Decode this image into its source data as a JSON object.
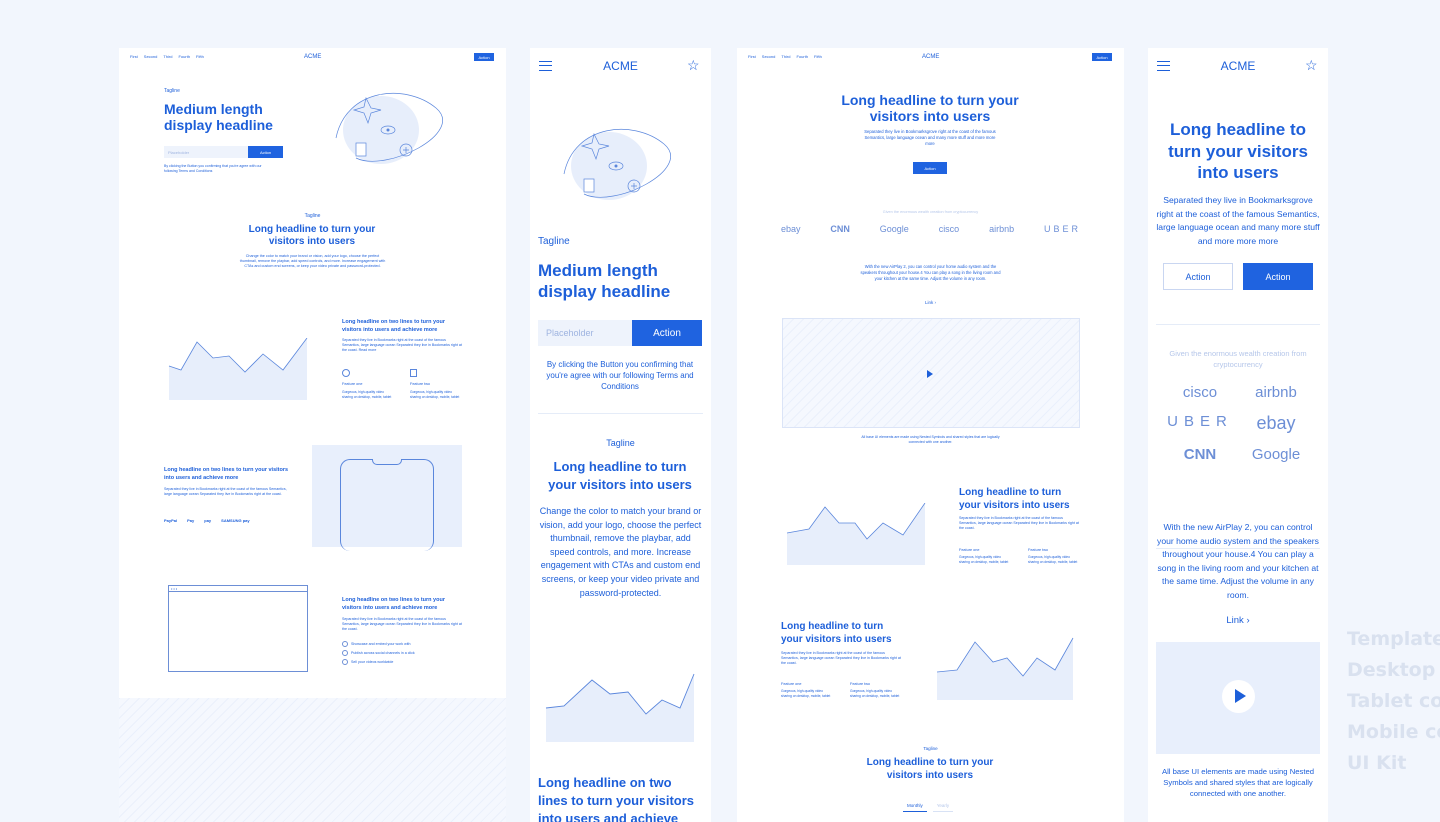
{
  "frame1": {
    "nav": [
      "First",
      "Second",
      "Third",
      "Fourth",
      "Fifth"
    ],
    "logo": "ACME",
    "action": "Action",
    "hero": {
      "tagline": "Tagline",
      "headline": "Medium length display headline",
      "placeholder": "Placeholder",
      "button": "Action",
      "legal": "By clicking the Button you confirming that you're agree with our following Terms and Conditions"
    },
    "section2": {
      "tagline": "Tagline",
      "headline": "Long headline to turn your visitors into users",
      "body": "Change the color to match your brand or vision, add your logo, choose the perfect thumbnail, remove the playbar, add speed controls, and more. Increase engagement with CTAs and custom end screens, or keep your video private and password-protected."
    },
    "section3": {
      "headline": "Long headline on two lines to turn your visitors into users and achieve more",
      "body": "Separated they live in Bookmarks right at the coast of the famous Semantics, large language ocean Separated they live in Bookmarks right at the coast. Read more",
      "f1_title": "Feature one",
      "f1_text": "Gorgeous, high-quality video sharing on desktop, mobile, tablet",
      "f2_title": "Feature two",
      "f2_text": "Gorgeous, high-quality video sharing on desktop, mobile, tablet"
    },
    "section4": {
      "headline": "Long headline on two lines to turn your visitors into users and achieve more",
      "body": "Separated they live in Bookmarks right at the coast of the famous Semantics, large language ocean Separated they live in Bookmarks right at the coast.",
      "logos": [
        "PayPal",
        "Pay",
        "pay",
        "SAMSUNG pay"
      ]
    },
    "section5": {
      "headline": "Long headline on two lines to turn your visitors into users and achieve more",
      "body": "Separated they live in Bookmarks right at the coast of the famous Semantics, large language ocean Separated they live in Bookmarks right at the coast.",
      "checks": [
        "Showcase and embed your work with",
        "Publish across social channels in a click",
        "Sell your videos worldwide"
      ]
    }
  },
  "frame2": {
    "logo": "ACME",
    "tagline": "Tagline",
    "headline": "Medium length display headline",
    "placeholder": "Placeholder",
    "button": "Action",
    "legal": "By clicking the Button you confirming that you're agree with our following Terms and Conditions",
    "tagline2": "Tagline",
    "headline2": "Long headline to turn your visitors into users",
    "body2": "Change the color to match your brand or vision, add your logo, choose the perfect thumbnail, remove the playbar, add speed controls, and more. Increase engagement with CTAs and custom end screens, or keep your video private and password-protected.",
    "headline3": "Long headline on two lines to turn your visitors into users and achieve"
  },
  "frame3": {
    "nav": [
      "First",
      "Second",
      "Third",
      "Fourth",
      "Fifth"
    ],
    "logo": "ACME",
    "action": "Action",
    "headline": "Long headline to turn your visitors into users",
    "body": "Separated they live in Bookmarksgrove right at the coast of the famous Semantics, large language ocean and many more stuff and more more more",
    "button": "Action",
    "logos_caption": "Given the enormous wealth creation from cryptocurrency",
    "logos": [
      "ebay",
      "CNN",
      "Google",
      "cisco",
      "airbnb",
      "UBER"
    ],
    "airplay": "With the new AirPlay 2, you can control your home audio system and the speakers throughout your house.4 You can play a song in the living room and your kitchen at the same time. Adjust the volume in any room.",
    "link": "Link ›",
    "video_caption": "All base UI elements are made using Nested Symbols and shared styles that are logically connected with one another.",
    "s1_headline": "Long headline to turn your visitors into users",
    "s1_body": "Separated they live in Bookmarks right at the coast of the famous Semantics, large language ocean Separated they live in Bookmarks right at the coast.",
    "s2_headline": "Long headline to turn your visitors into users",
    "s2_body": "Separated they live in Bookmarks right at the coast of the famous Semantics, large language ocean Separated they live in Bookmarks right at the coast.",
    "f1_title": "Feature one",
    "f1_text": "Gorgeous, high-quality video sharing on desktop, mobile, tablet",
    "f2_title": "Feature two",
    "f2_text": "Gorgeous, high-quality video sharing on desktop, mobile, tablet",
    "tagline": "Tagline",
    "bottom_headline": "Long headline to turn your visitors into users",
    "tabs": [
      "Monthly",
      "Yearly"
    ]
  },
  "frame4": {
    "logo": "ACME",
    "headline": "Long headline to turn your visitors into users",
    "body": "Separated they live in Bookmarksgrove right at the coast of the famous Semantics, large language ocean and many more stuff and more more more",
    "btn1": "Action",
    "btn2": "Action",
    "logos_caption": "Given the enormous wealth creation from cryptocurrency",
    "logos": [
      "cisco",
      "airbnb",
      "UBER",
      "ebay",
      "CNN",
      "Google"
    ],
    "airplay": "With the new AirPlay 2, you can control your home audio system and the speakers throughout your house.4 You can play a song in the living room and your kitchen at the same time. Adjust the volume in any room.",
    "link": "Link ›",
    "video_caption": "All base UI elements are made using Nested Symbols and shared styles that are logically connected with one another."
  },
  "sidebar": [
    "Templates",
    "Desktop c",
    "Tablet cor",
    "Mobile cor",
    "UI Kit"
  ],
  "colors": {
    "accent": "#1f63e0",
    "text": "#1d5fd9",
    "background": "#f2f6fd"
  }
}
